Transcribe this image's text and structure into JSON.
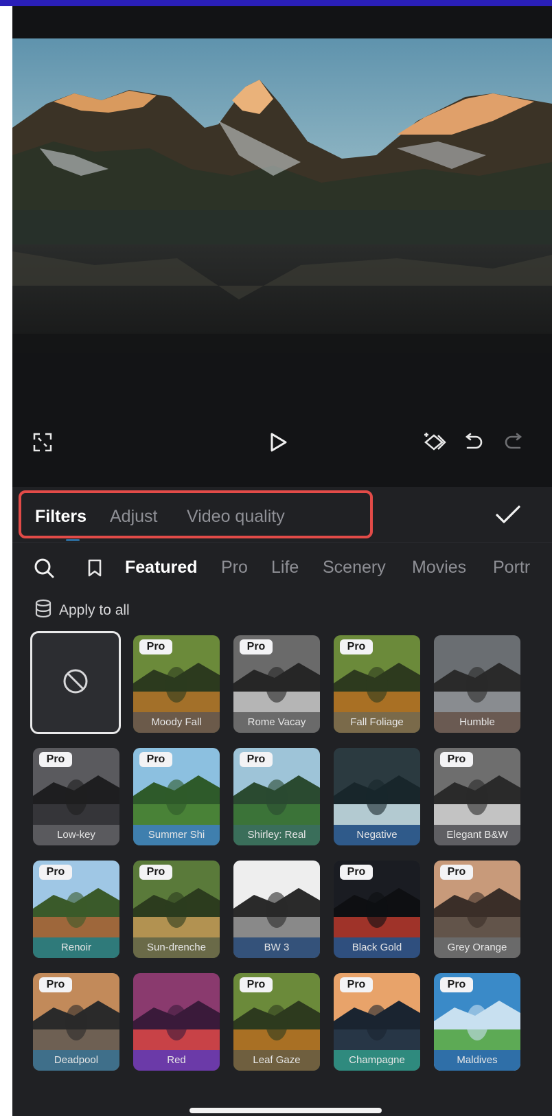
{
  "editor": {
    "tabs": [
      {
        "label": "Filters",
        "active": true
      },
      {
        "label": "Adjust",
        "active": false
      },
      {
        "label": "Video quality",
        "active": false
      }
    ]
  },
  "categories": [
    {
      "label": "Featured",
      "active": true
    },
    {
      "label": "Pro",
      "active": false
    },
    {
      "label": "Life",
      "active": false
    },
    {
      "label": "Scenery",
      "active": false
    },
    {
      "label": "Movies",
      "active": false
    },
    {
      "label": "Portr",
      "active": false
    }
  ],
  "apply_all": {
    "label": "Apply to all"
  },
  "filters": {
    "pro_badge": "Pro",
    "items": [
      {
        "label": "Moody Fall",
        "pro": true
      },
      {
        "label": "Rome Vacay",
        "pro": true
      },
      {
        "label": "Fall Foliage",
        "pro": true
      },
      {
        "label": "Humble",
        "pro": false
      },
      {
        "label": "Low-key",
        "pro": true
      },
      {
        "label": "Summer Shi",
        "pro": true
      },
      {
        "label": "Shirley: Real",
        "pro": true
      },
      {
        "label": "Negative",
        "pro": false
      },
      {
        "label": "Elegant B&W",
        "pro": true
      },
      {
        "label": "Renoir",
        "pro": true
      },
      {
        "label": "Sun-drenche",
        "pro": true
      },
      {
        "label": "BW 3",
        "pro": false
      },
      {
        "label": "Black Gold",
        "pro": true
      },
      {
        "label": "Grey Orange",
        "pro": true
      },
      {
        "label": "Deadpool",
        "pro": true
      },
      {
        "label": "Red",
        "pro": false
      },
      {
        "label": "Leaf Gaze",
        "pro": true
      },
      {
        "label": "Champagne",
        "pro": true
      },
      {
        "label": "Maldives",
        "pro": true
      }
    ]
  },
  "colors": {
    "highlight_border": "#e24b48",
    "panel_bg": "#202124",
    "active_text": "#ffffff",
    "inactive_text": "#8e8f95"
  },
  "icons": {
    "fullscreen": "fullscreen-icon",
    "play": "play-icon",
    "keyframe": "keyframe-icon",
    "undo": "undo-icon",
    "redo": "redo-icon",
    "confirm": "checkmark-icon",
    "search": "search-icon",
    "bookmark": "bookmark-icon",
    "apply_all": "layers-icon",
    "none": "no-filter-icon"
  }
}
